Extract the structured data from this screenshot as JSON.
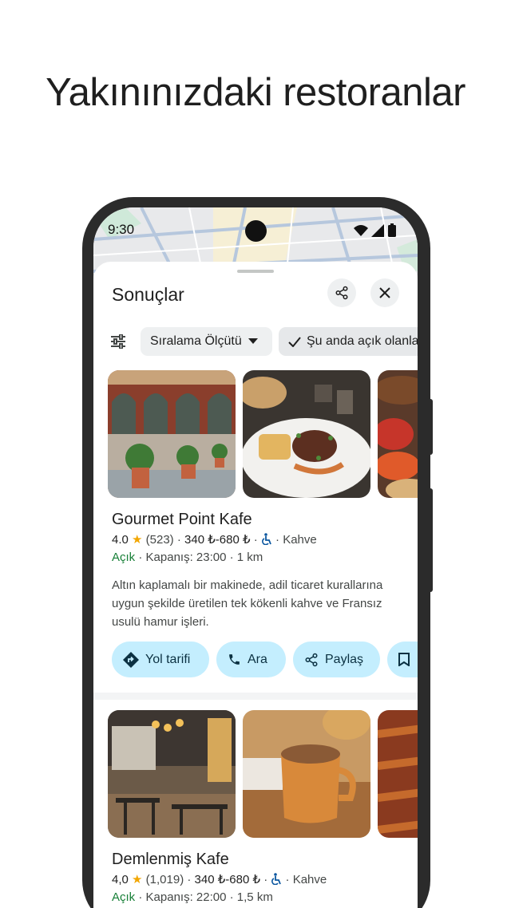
{
  "headline": "Yakınınızdaki restoranlar",
  "status_bar": {
    "time": "9:30"
  },
  "sheet": {
    "title": "Sonuçlar",
    "share_icon": "share-icon",
    "close_icon": "close-icon"
  },
  "filters": {
    "filter_icon": "tune-icon",
    "sort_label": "Sıralama Ölçütü",
    "open_now_label": "Şu anda açık olanlar"
  },
  "results": [
    {
      "name": "Gourmet Point Kafe",
      "rating": "4.0",
      "reviews": "(523)",
      "price": "340 ₺-680 ₺",
      "accessibility_icon": "wheelchair-icon",
      "category": "Kahve",
      "status": "Açık",
      "closing": "Kapanış: 23:00",
      "distance": "1 km",
      "description": "Altın kaplamalı bir makinede, adil ticaret kurallarına uygun şekilde üretilen tek kökenli kahve ve Fransız usulü hamur işleri.",
      "actions": {
        "directions": "Yol tarifi",
        "call": "Ara",
        "share": "Paylaş"
      }
    },
    {
      "name": "Demlenmiş Kafe",
      "rating": "4,0",
      "reviews": "(1,019)",
      "price": "340 ₺-680 ₺",
      "accessibility_icon": "wheelchair-icon",
      "category": "Kahve",
      "status": "Açık",
      "closing": "Kapanış: 22:00",
      "distance": "1,5 km"
    }
  ],
  "colors": {
    "accent_chip": "#c4eefe",
    "open_green": "#188038",
    "star": "#f2a600"
  }
}
